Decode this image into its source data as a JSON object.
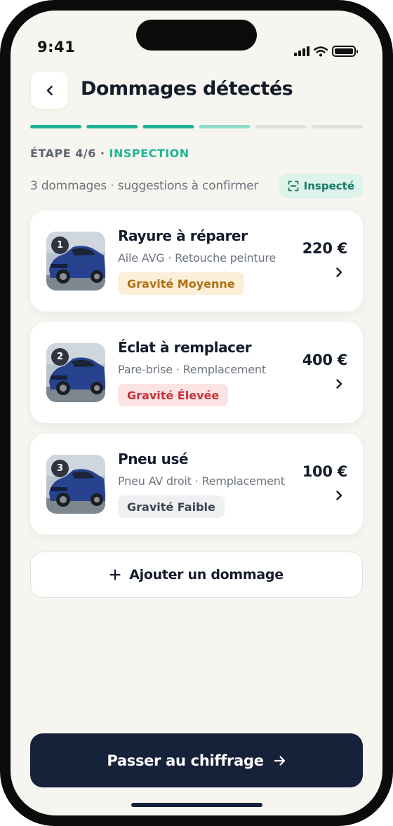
{
  "status_bar": {
    "time": "9:41"
  },
  "header": {
    "title": "Dommages détectés",
    "back_icon": "chevron-left-icon"
  },
  "progress": {
    "total_steps": 6,
    "current_step": 4
  },
  "step": {
    "count": "ÉTAPE 4/6",
    "separator": " · ",
    "label": "INSPECTION"
  },
  "summary": {
    "text": "3 dommages · suggestions à confirmer",
    "badge": "Inspecté",
    "badge_icon": "scan-icon"
  },
  "damages": [
    {
      "number": "1",
      "title": "Rayure à réparer",
      "subtitle": "Aile AVG · Retouche peinture",
      "severity": "Gravité Moyenne",
      "severity_level": "medium",
      "price": "220 €"
    },
    {
      "number": "2",
      "title": "Éclat à remplacer",
      "subtitle": "Pare-brise · Remplacement",
      "severity": "Gravité Élevée",
      "severity_level": "high",
      "price": "400 €"
    },
    {
      "number": "3",
      "title": "Pneu usé",
      "subtitle": "Pneu AV droit · Remplacement",
      "severity": "Gravité Faible",
      "severity_level": "low",
      "price": "100 €"
    }
  ],
  "add_button": {
    "label": "Ajouter un dommage"
  },
  "primary_button": {
    "label": "Passer au chiffrage"
  },
  "colors": {
    "accent": "#1fb596",
    "accent_light": "#8fdcc9",
    "track": "#dfe2df",
    "navy": "#16213a",
    "background": "#f6f5ef"
  }
}
